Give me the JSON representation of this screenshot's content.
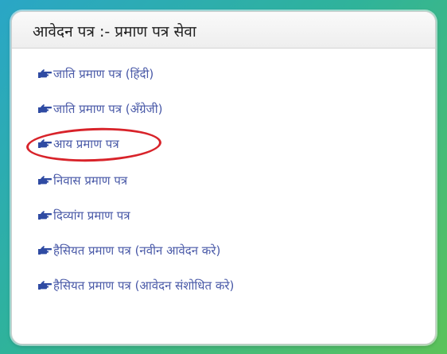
{
  "panel": {
    "title": "आवेदन पत्र :-  प्रमाण पत्र सेवा"
  },
  "menu": {
    "items": [
      {
        "label": "जाति प्रमाण पत्र (हिंदी)"
      },
      {
        "label": "जाति प्रमाण पत्र (अँग्रेजी)"
      },
      {
        "label": "आय प्रमाण पत्र"
      },
      {
        "label": "निवास प्रमाण पत्र"
      },
      {
        "label": "दिव्यांग प्रमाण पत्र"
      },
      {
        "label": "हैसियत प्रमाण पत्र (नवीन आवेदन करे)"
      },
      {
        "label": "हैसियत प्रमाण पत्र (आवेदन संशोधित करे)"
      }
    ]
  },
  "colors": {
    "link": "#4a5aa8",
    "highlight": "#d8232a"
  },
  "icons": {
    "item_bullet": "pointing-hand-icon"
  }
}
